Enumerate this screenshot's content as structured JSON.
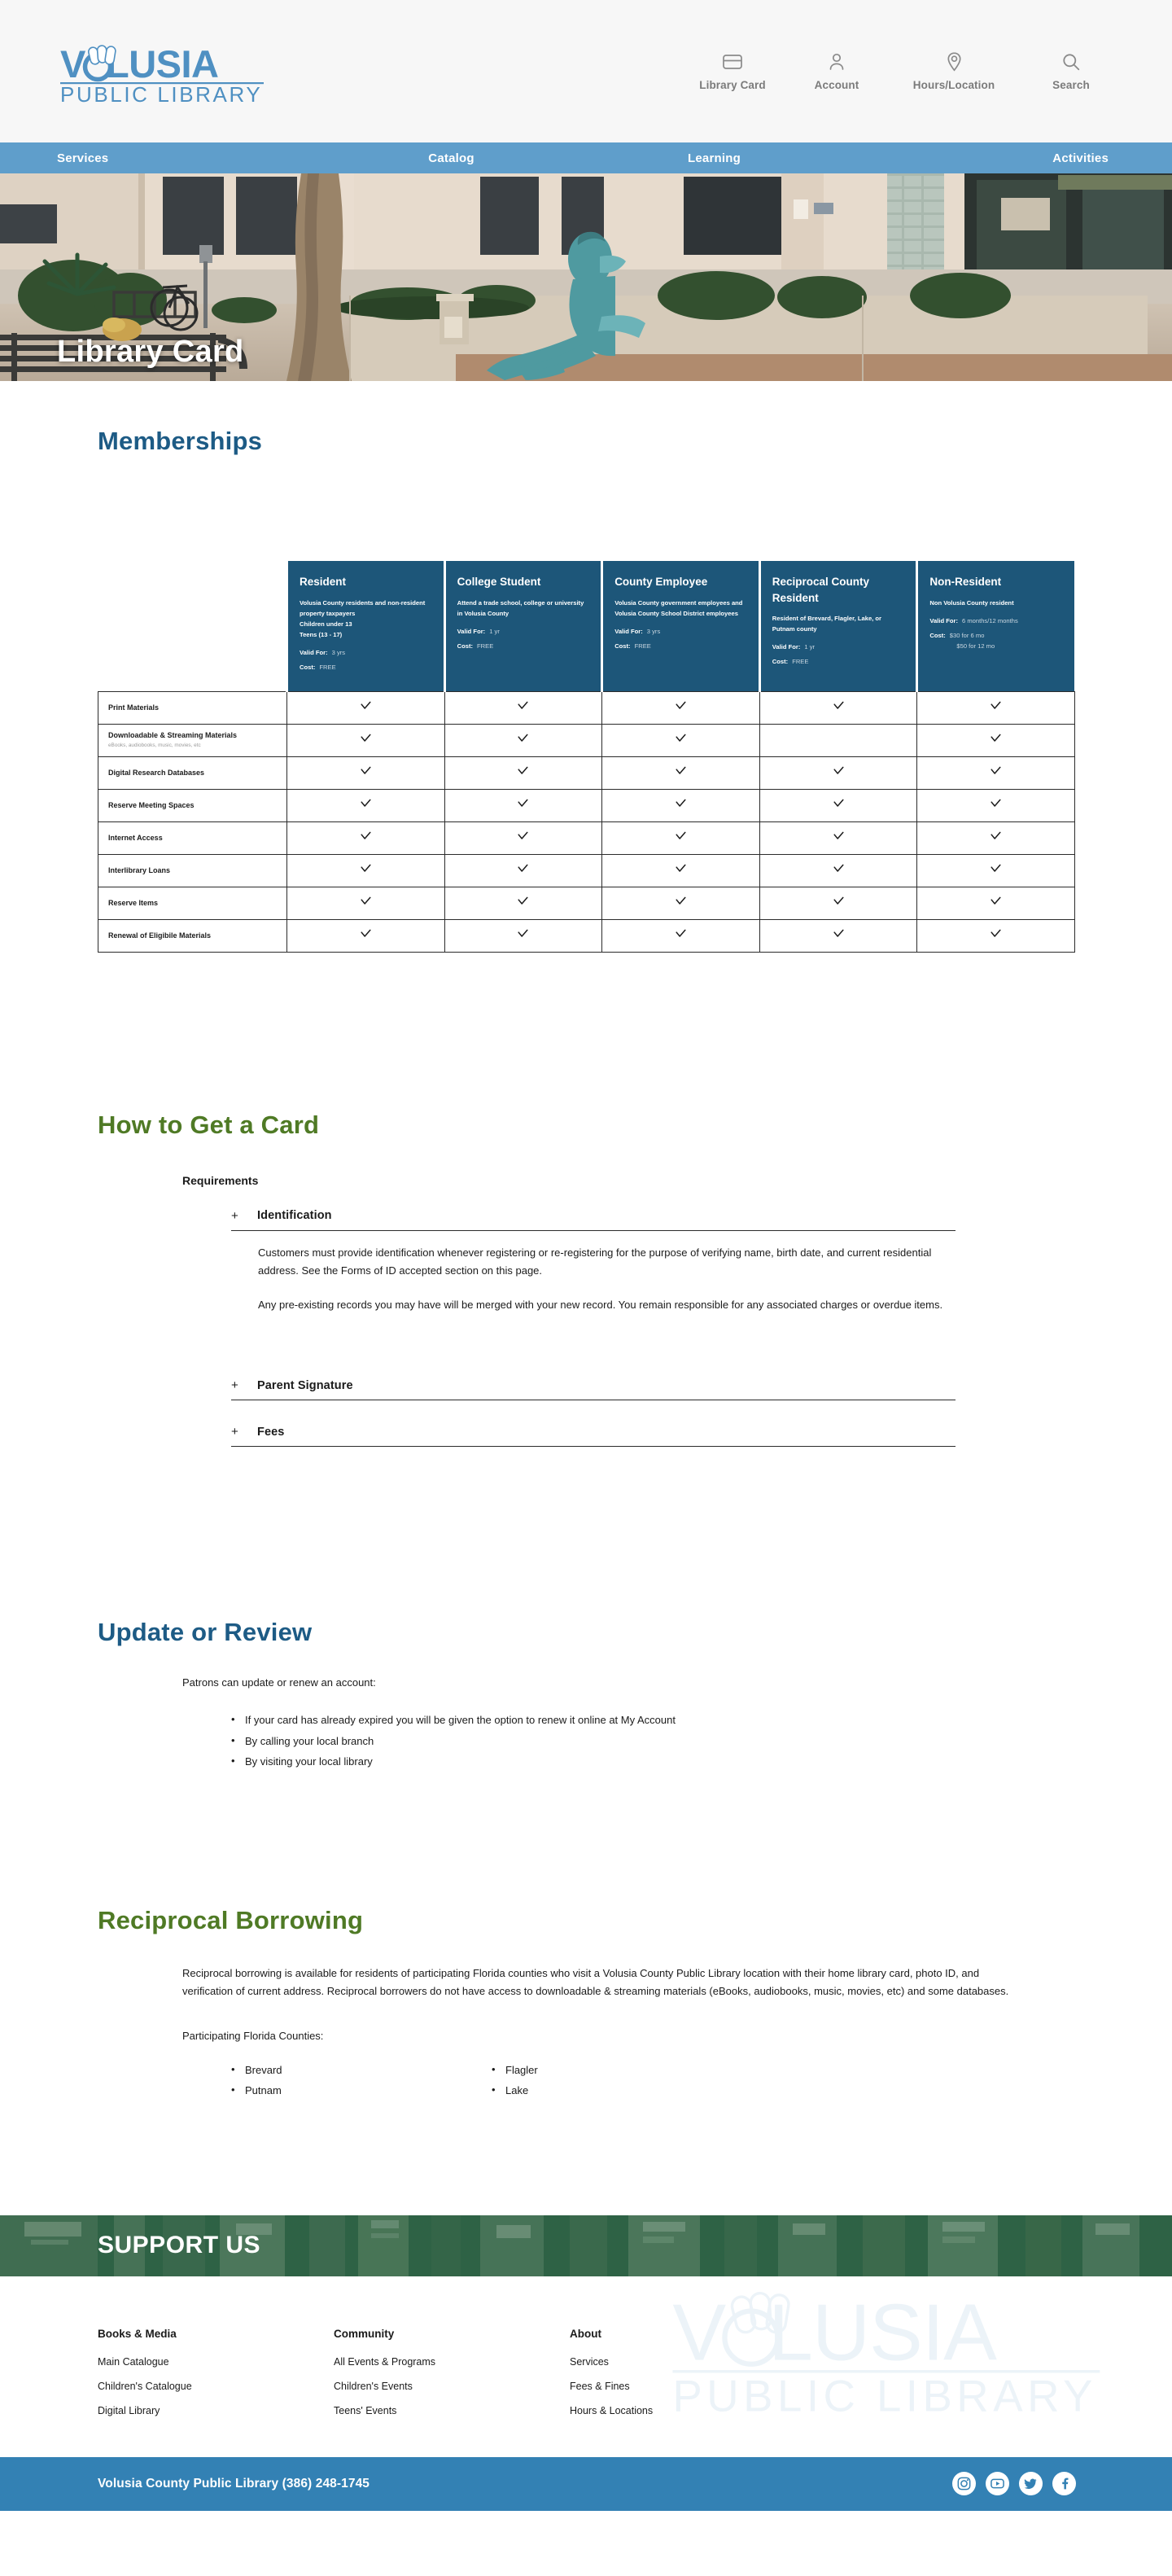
{
  "header": {
    "logo_line1": "VOLUSIA",
    "logo_line2": "PUBLIC LIBRARY",
    "utility_nav": [
      {
        "label": "Library Card",
        "icon": "card-icon"
      },
      {
        "label": "Account",
        "icon": "person-icon"
      },
      {
        "label": "Hours/Location",
        "icon": "map-pin-icon"
      },
      {
        "label": "Search",
        "icon": "search-icon"
      }
    ],
    "main_nav": [
      "Services",
      "Catalog",
      "Learning",
      "Activities"
    ],
    "nav_bg": "#5f9ecb"
  },
  "hero": {
    "title": "Library Card"
  },
  "memberships": {
    "heading": "Memberships",
    "heading_color": "#1d5b85",
    "header_bg": "#1d5679",
    "columns": [
      {
        "title": "Resident",
        "desc": "Volusia County residents and non-resident property taxpayers\nChildren under 13\nTeens (13 - 17)",
        "valid_label": "Valid For:",
        "valid_value": "3 yrs",
        "cost_label": "Cost:",
        "cost_value": "FREE",
        "cost_value2": ""
      },
      {
        "title": "College Student",
        "desc": "Attend a trade school, college or university in Volusia County",
        "valid_label": "Valid For:",
        "valid_value": "1 yr",
        "cost_label": "Cost:",
        "cost_value": "FREE",
        "cost_value2": ""
      },
      {
        "title": "County Employee",
        "desc": " Volusia County government employees and Volusia County School District employees",
        "valid_label": "Valid For:",
        "valid_value": "3 yrs",
        "cost_label": "Cost:",
        "cost_value": "FREE",
        "cost_value2": ""
      },
      {
        "title": "Reciprocal County Resident",
        "desc": "Resident of Brevard, Flagler, Lake, or Putnam county",
        "valid_label": "Valid For:",
        "valid_value": "1 yr",
        "cost_label": "Cost:",
        "cost_value": "FREE",
        "cost_value2": ""
      },
      {
        "title": "Non-Resident",
        "desc": " Non Volusia County resident",
        "valid_label": "Valid For:",
        "valid_value": "6 months/12 months",
        "cost_label": "Cost:",
        "cost_value": "$30 for 6 mo",
        "cost_value2": "$50 for 12 mo"
      }
    ],
    "rows": [
      {
        "label": "Print Materials",
        "sub": "",
        "marks": [
          true,
          true,
          true,
          true,
          true
        ]
      },
      {
        "label": "Downloadable & Streaming Materials",
        "sub": "eBooks, audiobooks, music, movies, etc",
        "marks": [
          true,
          true,
          true,
          false,
          true
        ]
      },
      {
        "label": "Digital Research Databases",
        "sub": "",
        "marks": [
          true,
          true,
          true,
          true,
          true
        ]
      },
      {
        "label": "Reserve Meeting Spaces",
        "sub": "",
        "marks": [
          true,
          true,
          true,
          true,
          true
        ]
      },
      {
        "label": "Internet Access",
        "sub": "",
        "marks": [
          true,
          true,
          true,
          true,
          true
        ]
      },
      {
        "label": "Interlibrary Loans",
        "sub": "",
        "marks": [
          true,
          true,
          true,
          true,
          true
        ]
      },
      {
        "label": "Reserve Items",
        "sub": "",
        "marks": [
          true,
          true,
          true,
          true,
          true
        ]
      },
      {
        "label": "Renewal of Eligibile Materials",
        "sub": "",
        "marks": [
          true,
          true,
          true,
          true,
          true
        ]
      }
    ]
  },
  "how_to_get": {
    "heading": "How to Get a Card",
    "heading_color": "#4f7a25",
    "requirements_label": "Requirements",
    "items": [
      {
        "title": "Identification",
        "toggle": "+",
        "open": true,
        "p1": "Customers must provide identification whenever registering or re-registering for the purpose of verifying name, birth date, and current residential address. See the Forms of ID accepted section on this page.",
        "p2": "Any pre-existing records you may have will be merged with your new record. You remain responsible for any associated charges or overdue items."
      },
      {
        "title": "Parent Signature",
        "toggle": "+",
        "open": false
      },
      {
        "title": "Fees",
        "toggle": "+",
        "open": false
      }
    ]
  },
  "update_review": {
    "heading": "Update or Review",
    "heading_color": "#1d5b85",
    "lead": "Patrons can update or renew an account:",
    "bullets": [
      "If your card has already expired you will be given the option to renew it online at My Account",
      "By calling your local branch",
      "By visiting your local library"
    ]
  },
  "reciprocal": {
    "heading": "Reciprocal Borrowing",
    "heading_color": "#4f7a25",
    "body": "Reciprocal borrowing is available for residents of participating Florida counties who visit a Volusia County Public Library location with their home library card, photo ID, and verification of current address. Reciprocal borrowers do not have access to downloadable & streaming materials (eBooks, audiobooks, music, movies, etc) and some databases.",
    "counties_label": "Participating Florida Counties:",
    "counties_col1": [
      "Brevard",
      "Putnam"
    ],
    "counties_col2": [
      "Flagler",
      "Lake"
    ]
  },
  "support": {
    "title": "SUPPORT US"
  },
  "footer": {
    "columns": [
      {
        "heading": "Books & Media",
        "links": [
          "Main Catalogue",
          "Children's Catalogue",
          "Digital Library"
        ]
      },
      {
        "heading": "Community",
        "links": [
          "All Events & Programs",
          "Children's Events",
          "Teens' Events"
        ]
      },
      {
        "heading": "About",
        "links": [
          "Services",
          "Fees & Fines",
          "Hours & Locations"
        ]
      }
    ],
    "watermark_line1": "VOLUSIA",
    "watermark_line2": "PUBLIC LIBRARY"
  },
  "bottom_bar": {
    "text": "Volusia County Public Library (386) 248-1745",
    "bg": "#3381b4",
    "socials": [
      "instagram-icon",
      "youtube-icon",
      "twitter-icon",
      "facebook-icon"
    ]
  }
}
